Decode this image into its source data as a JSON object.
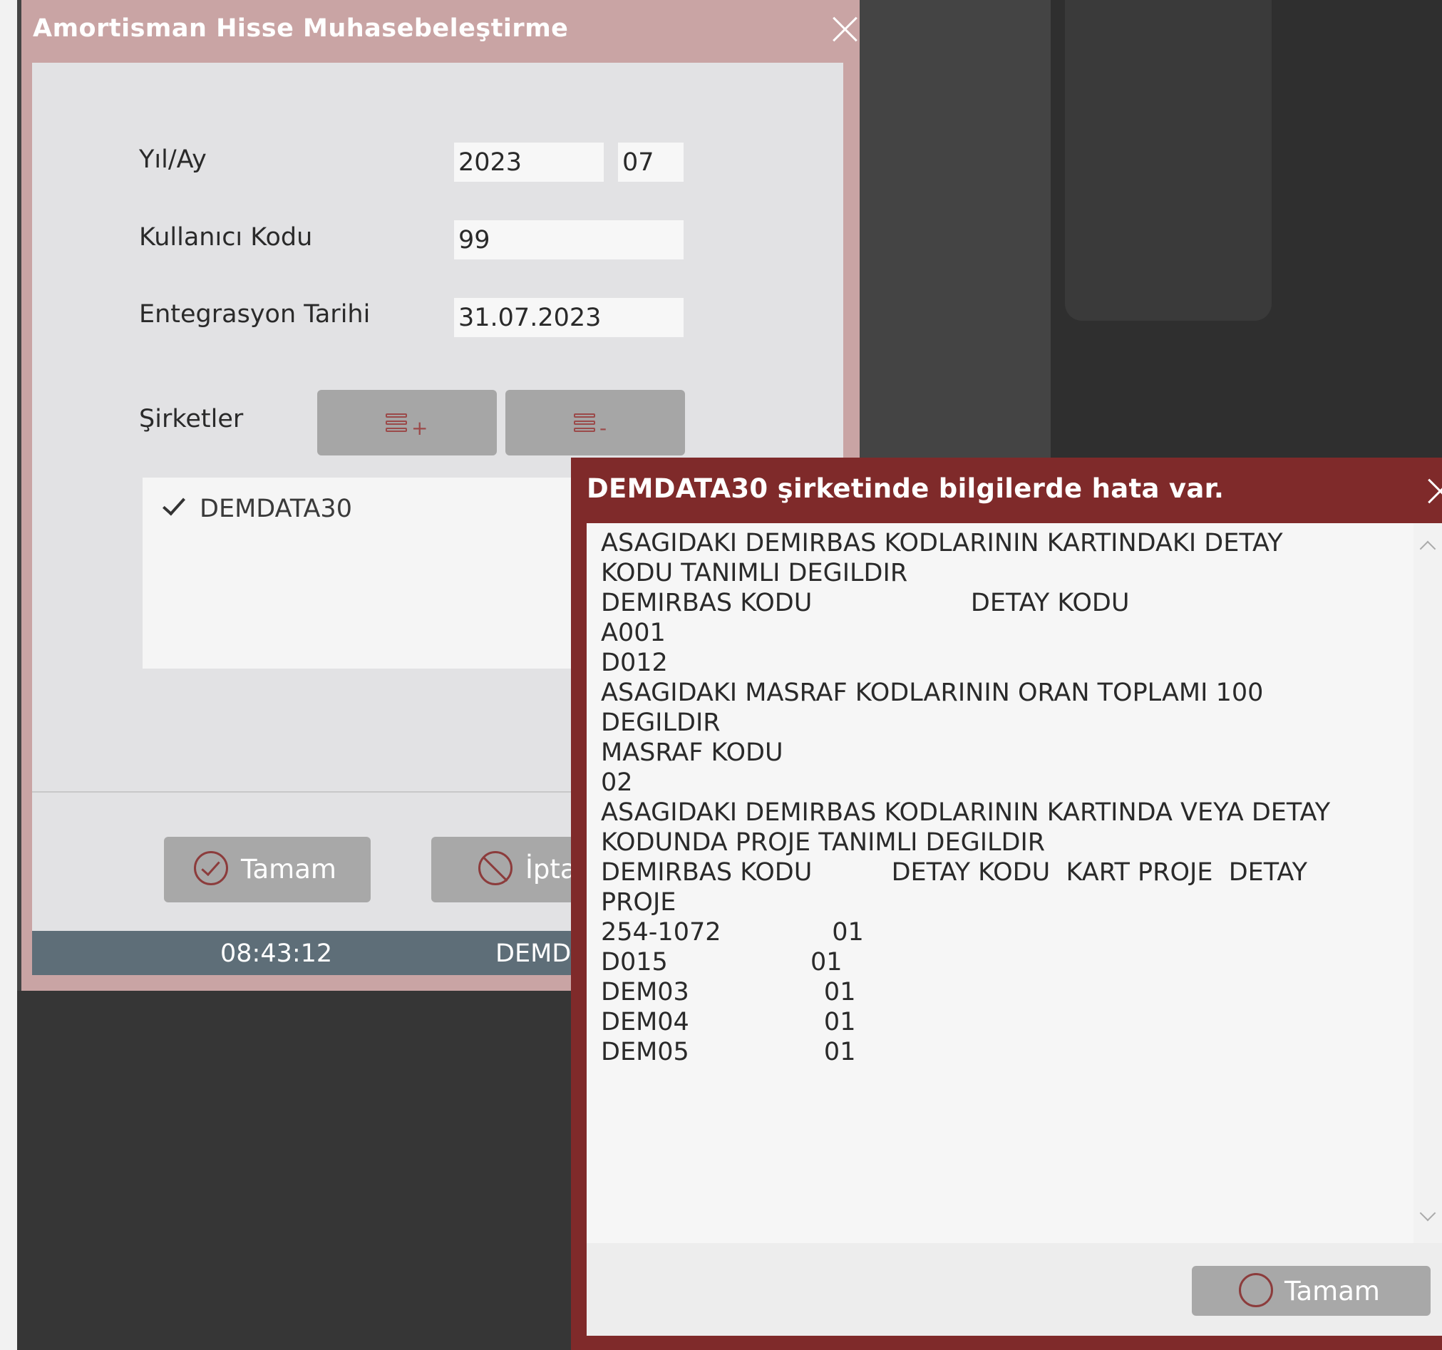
{
  "colors": {
    "title_bar": "#c9a4a4",
    "error_title_bar": "#7f2a2a",
    "body": "#e2e2e4",
    "button": "#a8a8a8",
    "status_bar": "#5e6e78",
    "icon_accent": "#8c3c3c"
  },
  "main_dialog": {
    "title": "Amortisman Hisse Muhasebeleştirme",
    "fields": {
      "year_month_label": "Yıl/Ay",
      "year_value": "2023",
      "month_value": "07",
      "user_code_label": "Kullanıcı Kodu",
      "user_code_value": "99",
      "integration_date_label": "Entegrasyon Tarihi",
      "integration_date_value": "31.07.2023"
    },
    "companies": {
      "label": "Şirketler",
      "add_icon": "list-add-icon",
      "remove_icon": "list-remove-icon",
      "items": [
        {
          "label": "DEMDATA30",
          "checked": true
        }
      ]
    },
    "buttons": {
      "ok_label": "Tamam",
      "cancel_label": "İpta"
    },
    "status_bar": {
      "time": "08:43:12",
      "database": "DEMD"
    }
  },
  "error_dialog": {
    "title": "DEMDATA30 şirketinde bilgilerde hata var.",
    "lines": [
      "ASAGIDAKI DEMIRBAS KODLARININ KARTINDAKI DETAY",
      "KODU TANIMLI DEGILDIR",
      "DEMIRBAS KODU                    DETAY KODU",
      "A001",
      "D012",
      "ASAGIDAKI MASRAF KODLARININ ORAN TOPLAMI 100",
      "DEGILDIR",
      "MASRAF KODU",
      "02",
      "ASAGIDAKI DEMIRBAS KODLARININ KARTINDA VEYA DETAY",
      "KODUNDA PROJE TANIMLI DEGILDIR",
      "DEMIRBAS KODU          DETAY KODU  KART PROJE  DETAY",
      "PROJE",
      "254-1072              01",
      "D015                  01",
      "DEM03                 01",
      "DEM04                 01",
      "DEM05                 01"
    ],
    "ok_label": "Tamam"
  }
}
